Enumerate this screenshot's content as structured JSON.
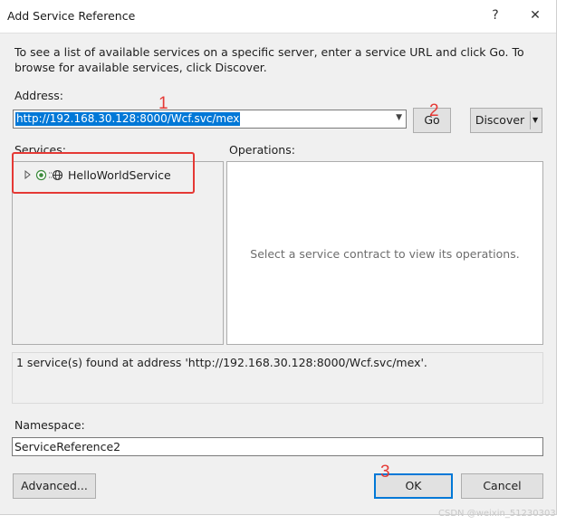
{
  "window": {
    "title": "Add Service Reference",
    "help_glyph": "?",
    "close_glyph": "✕"
  },
  "description": "To see a list of available services on a specific server, enter a service URL and click Go. To browse for available services, click Discover.",
  "address": {
    "label": "Address:",
    "value": "http://192.168.30.128:8000/Wcf.svc/mex"
  },
  "buttons": {
    "go": "Go",
    "discover": "Discover",
    "advanced": "Advanced...",
    "ok": "OK",
    "cancel": "Cancel"
  },
  "services": {
    "label": "Services:",
    "items": [
      {
        "name": "HelloWorldService"
      }
    ]
  },
  "operations": {
    "label": "Operations:",
    "empty_message": "Select a service contract to view its operations."
  },
  "status": "1 service(s) found at address 'http://192.168.30.128:8000/Wcf.svc/mex'.",
  "namespace": {
    "label": "Namespace:",
    "value": "ServiceReference2"
  },
  "annotations": {
    "n1": "1",
    "n2": "2",
    "n3": "3",
    "color": "#e53935"
  },
  "watermark": "CSDN @weixin_51230303",
  "colors": {
    "selection": "#0078d7",
    "dialog_bg": "#f0f0f0",
    "button_bg": "#e1e1e1"
  }
}
